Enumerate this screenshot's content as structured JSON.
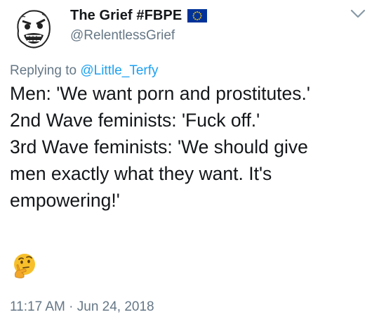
{
  "user": {
    "display_name": "The Grief #FBPE",
    "handle": "@RelentlessGrief",
    "flag_icon": "eu-flag-icon",
    "avatar_icon": "rage-face-avatar-icon"
  },
  "reply": {
    "prefix": "Replying to ",
    "mention": "@Little_Terfy"
  },
  "tweet": {
    "lines": [
      "Men: 'We want porn and prostitutes.'",
      "2nd Wave feminists: 'Fuck off.'",
      "3rd Wave feminists: 'We should give",
      "men exactly what they want. It's",
      "empowering!'"
    ],
    "emoji_icon": "thinking-face-icon",
    "timestamp": "11:17 AM · Jun 24, 2018"
  },
  "colors": {
    "text": "#14171a",
    "muted": "#657786",
    "link": "#1da1f2",
    "eu_blue": "#003399",
    "eu_gold": "#ffcc00"
  }
}
